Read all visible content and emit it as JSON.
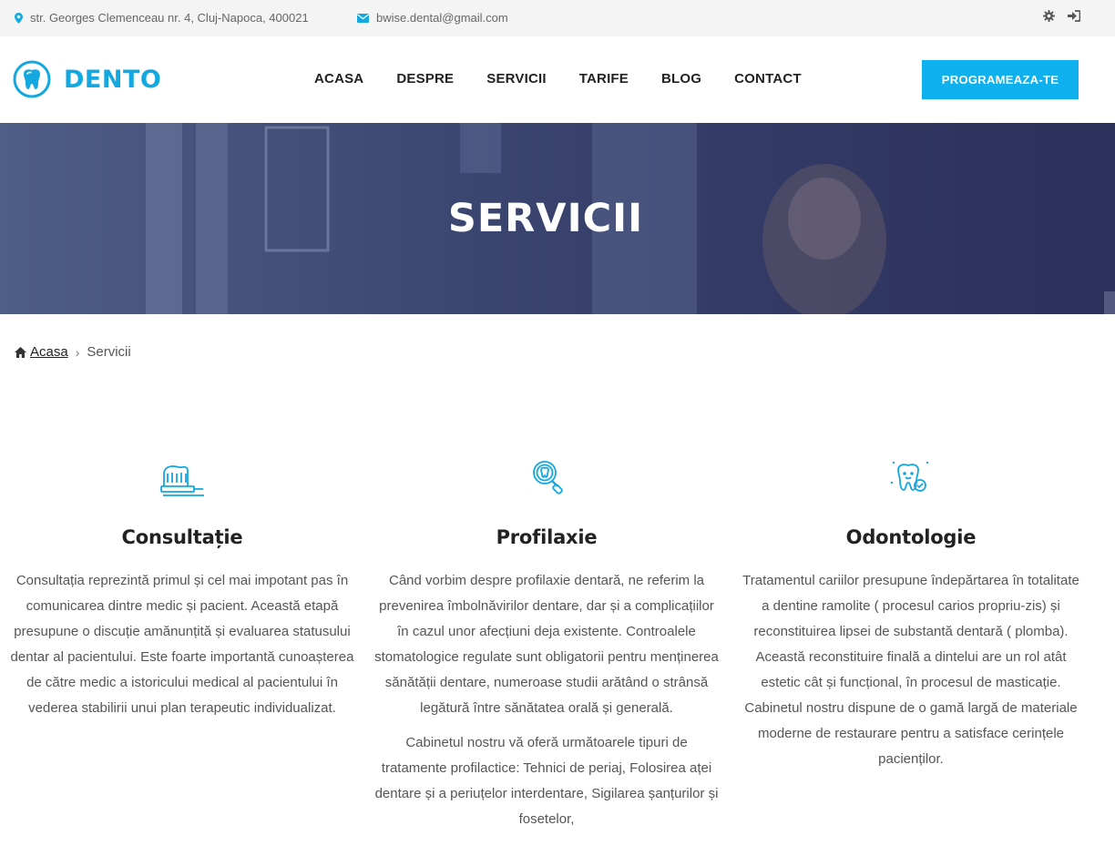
{
  "topbar": {
    "address": "str. Georges Clemenceau nr. 4, Cluj-Napoca, 400021",
    "email": "bwise.dental@gmail.com",
    "icons": [
      "map-marker-icon",
      "envelope-icon",
      "gear-icon",
      "sign-in-icon"
    ]
  },
  "header": {
    "brand": "DENTO",
    "nav": [
      "ACASA",
      "DESPRE",
      "SERVICII",
      "TARIFE",
      "BLOG",
      "CONTACT"
    ],
    "cta": "PROGRAMEAZA-TE"
  },
  "hero": {
    "title": "SERVICII"
  },
  "breadcrumb": {
    "home": "Acasa",
    "current": "Servicii"
  },
  "services": [
    {
      "icon": "toothbrush-icon",
      "title": "Consultație",
      "paragraphs": [
        "Consultația reprezintă primul și cel mai impotant pas în comunicarea dintre medic și pacient. Această etapă presupune o discuție amănunțită și evaluarea statusului dentar al pacientului. Este foarte importantă cunoașterea de către medic a istoricului medical al pacientului în vederea stabilirii unui plan terapeutic individualizat."
      ]
    },
    {
      "icon": "magnifier-tooth-icon",
      "title": "Profilaxie",
      "paragraphs": [
        "Când vorbim despre profilaxie dentară, ne referim la prevenirea îmbolnăvirilor dentare, dar și a complicațiilor în cazul unor afecțiuni deja existente. Controalele stomatologice regulate sunt obligatorii pentru menținerea sănătății dentare, numeroase studii arătând o strânsă legătură între sănătatea orală și generală.",
        "Cabinetul nostru vă oferă următoarele tipuri de tratamente profilactice: Tehnici de periaj, Folosirea aței dentare și a periuțelor interdentare, Sigilarea șanțurilor și fosetelor,"
      ]
    },
    {
      "icon": "happy-tooth-icon",
      "title": "Odontologie",
      "paragraphs": [
        "Tratamentul cariilor presupune îndepărtarea în totalitate a dentine ramolite ( procesul carios propriu-zis) și reconstituirea lipsei de substantă dentară ( plomba). Această reconstituire finală a dintelui are un rol atât estetic cât și funcțional, în procesul de masticație. Cabinetul nostru dispune de o gamă largă de materiale moderne de restaurare pentru a satisface cerințele pacienților."
      ]
    }
  ],
  "colors": {
    "accent": "#0eb1ed",
    "brand": "#13a8e0",
    "hero": "#343d68"
  }
}
